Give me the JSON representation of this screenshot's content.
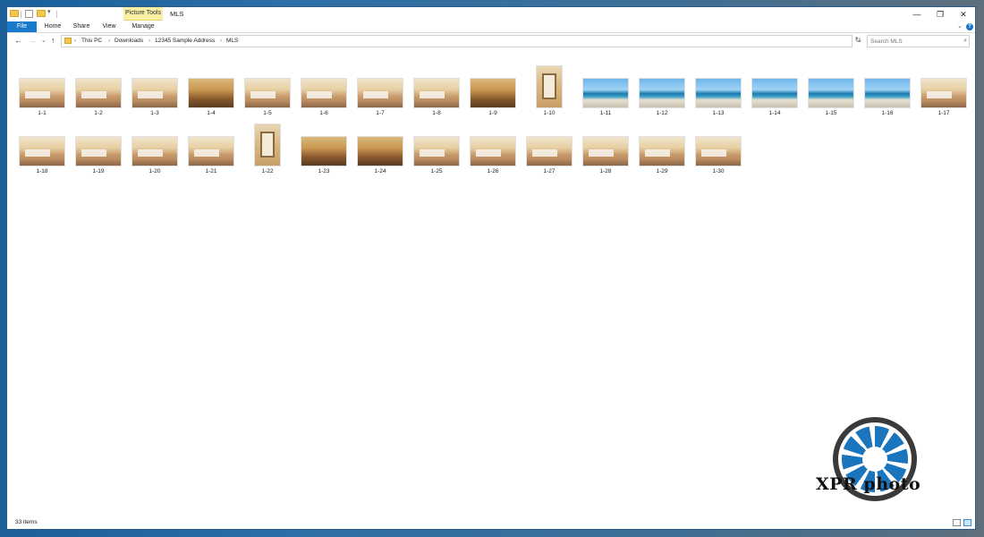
{
  "window": {
    "title": "MLS",
    "context_tab": "Picture Tools",
    "controls": {
      "minimize": "—",
      "maximize": "❐",
      "close": "✕"
    }
  },
  "ribbon": {
    "tabs": [
      "File",
      "Home",
      "Share",
      "View",
      "Manage"
    ]
  },
  "address_bar": {
    "crumbs": [
      "This PC",
      "Downloads",
      "12345 Sample Address",
      "MLS"
    ],
    "separator": "›"
  },
  "search": {
    "placeholder": "Search MLS"
  },
  "files": {
    "row1": [
      "1-1",
      "1-2",
      "1-3",
      "1-4",
      "1-5",
      "1-6",
      "1-7",
      "1-8",
      "1-9",
      "1-10",
      "1-11",
      "1-12",
      "1-13",
      "1-14",
      "1-15",
      "1-16",
      "1-17"
    ],
    "row2": [
      "1-18",
      "1-19",
      "1-20",
      "1-21",
      "1-22",
      "1-23",
      "1-24",
      "1-25",
      "1-26",
      "1-27",
      "1-28",
      "1-29",
      "1-30"
    ]
  },
  "status": {
    "item_count": "33 items"
  },
  "logo": {
    "text": "XPR photo"
  },
  "icons": {
    "back": "←",
    "forward": "→",
    "dropdown": "⌄",
    "up": "↑",
    "refresh": "↻",
    "search": "⌕",
    "help": "?"
  },
  "colors": {
    "file_tab": "#1979ca",
    "picture_tools": "#f7f0a6",
    "logo_blue": "#1b75bc"
  }
}
